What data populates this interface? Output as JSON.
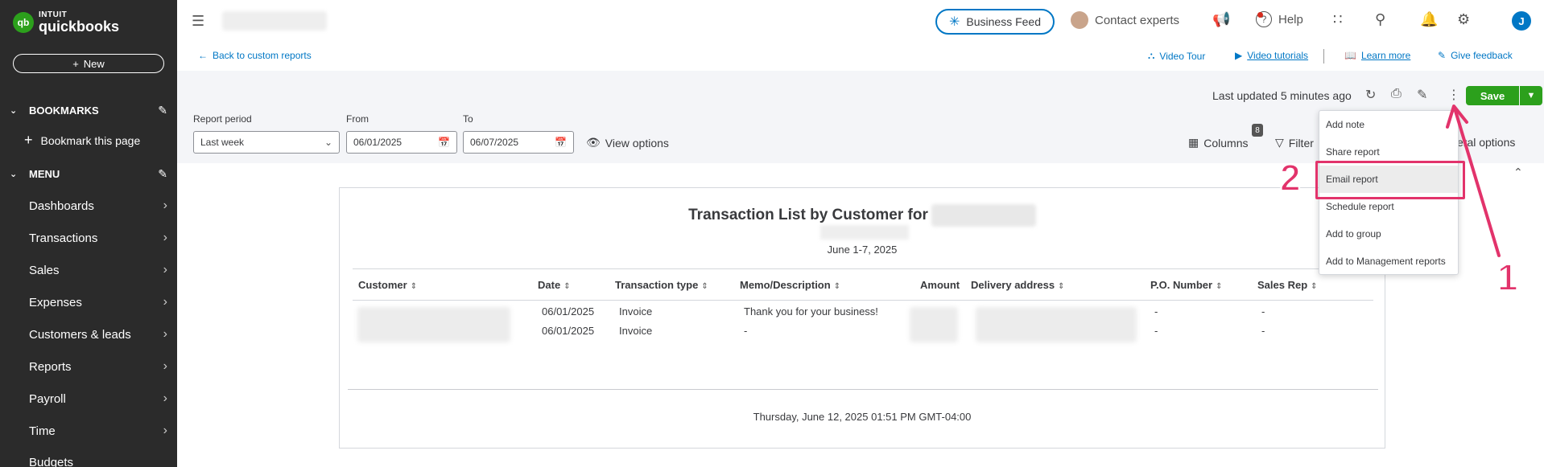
{
  "sidebar": {
    "logo_top": "INTUIT",
    "logo_bottom": "quickbooks",
    "new_label": "New",
    "bookmarks_label": "BOOKMARKS",
    "bookmark_this": "Bookmark this page",
    "menu_label": "MENU",
    "items": [
      {
        "label": "Dashboards"
      },
      {
        "label": "Transactions"
      },
      {
        "label": "Sales"
      },
      {
        "label": "Expenses"
      },
      {
        "label": "Customers & leads"
      },
      {
        "label": "Reports"
      },
      {
        "label": "Payroll"
      },
      {
        "label": "Time"
      },
      {
        "label": "Budgets"
      }
    ]
  },
  "topbar": {
    "business_feed": "Business Feed",
    "contact_experts": "Contact experts",
    "help": "Help",
    "user_initial": "J"
  },
  "subheader": {
    "back": "Back to custom reports",
    "video_tour": "Video Tour",
    "video_tutorials": "Video tutorials",
    "learn_more": "Learn more",
    "give_feedback": "Give feedback"
  },
  "filters": {
    "last_updated": "Last updated 5 minutes ago",
    "save": "Save",
    "report_period_label": "Report period",
    "report_period_value": "Last week",
    "from_label": "From",
    "from_value": "06/01/2025",
    "to_label": "To",
    "to_value": "06/07/2025",
    "view_options": "View options",
    "columns": "Columns",
    "columns_count": "8",
    "filter": "Filter",
    "general_options": "eral options"
  },
  "report": {
    "title": "Transaction List by Customer for",
    "date_range": "June 1-7, 2025",
    "columns": [
      "Customer",
      "Date",
      "Transaction type",
      "Memo/Description",
      "Amount",
      "Delivery address",
      "P.O. Number",
      "Sales Rep"
    ],
    "rows": [
      {
        "date": "06/01/2025",
        "type": "Invoice",
        "memo": "Thank you for your business!",
        "po": "-",
        "rep": "-"
      },
      {
        "date": "06/01/2025",
        "type": "Invoice",
        "memo": "-",
        "po": "-",
        "rep": "-"
      }
    ],
    "footer": "Thursday, June 12, 2025 01:51 PM GMT-04:00"
  },
  "menu": {
    "items": [
      {
        "label": "Add note"
      },
      {
        "label": "Share report"
      },
      {
        "label": "Email report"
      },
      {
        "label": "Schedule report"
      },
      {
        "label": "Add to group"
      },
      {
        "label": "Add to Management reports"
      }
    ]
  },
  "annotations": {
    "step1": "1",
    "step2": "2"
  },
  "colors": {
    "sidebar_bg": "#2b2b2b",
    "brand_green": "#2ca01c",
    "link_blue": "#0077c5",
    "annotation_pink": "#e2336b"
  }
}
